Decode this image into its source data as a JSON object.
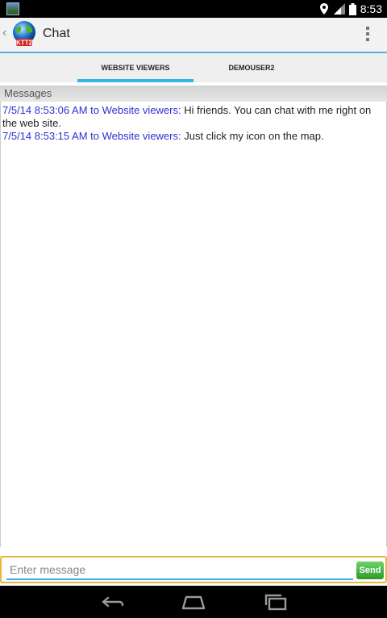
{
  "status_bar": {
    "time": "8:53",
    "icons": [
      "location-icon",
      "signal-icon",
      "battery-icon"
    ]
  },
  "action_bar": {
    "logo_text": "KTT2",
    "title": "Chat"
  },
  "tabs": [
    {
      "label": "WEBSITE VIEWERS",
      "active": true
    },
    {
      "label": "DEMOUSER2",
      "active": false
    }
  ],
  "messages_header": "Messages",
  "messages": [
    {
      "meta": "7/5/14 8:53:06 AM to Website viewers:",
      "text": " Hi friends. You can chat with me right on the web site."
    },
    {
      "meta": "7/5/14 8:53:15 AM to Website viewers:",
      "text": " Just click my icon on the map."
    }
  ],
  "composer": {
    "placeholder": "Enter message",
    "value": "",
    "send_label": "Send"
  },
  "colors": {
    "accent": "#33b5e5",
    "message_meta": "#2f2fd0",
    "send_button": "#3aa838",
    "input_border": "#f0b23e"
  }
}
